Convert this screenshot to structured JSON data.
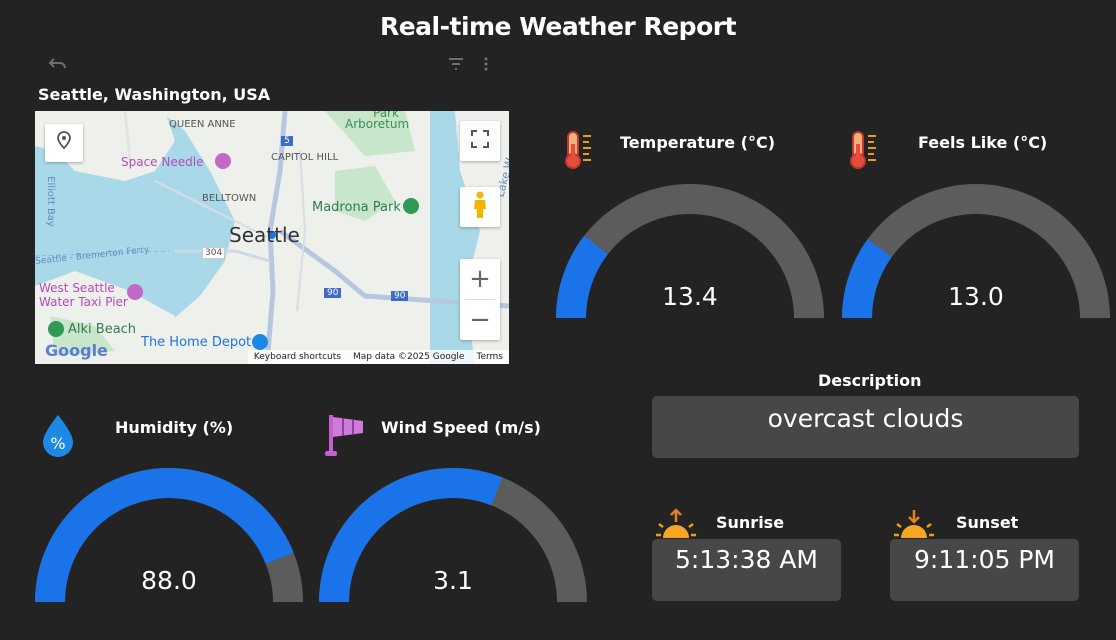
{
  "header": {
    "title": "Real-time Weather Report"
  },
  "toolbar": {
    "undo_icon": "undo-icon",
    "filter_icon": "filter-icon",
    "more_icon": "more-vert-icon"
  },
  "map": {
    "location": "Seattle, Washington, USA",
    "labels": {
      "city": "Seattle",
      "queen_anne": "QUEEN ANNE",
      "park": "Park",
      "arboretum": "Arboretum",
      "capitol_hill": "CAPITOL HILL",
      "space_needle": "Space Needle",
      "belltown": "BELLTOWN",
      "madrona_park": "Madrona Park",
      "elliott_bay": "Elliott Bay",
      "ferry": "Seattle - Bremerton Ferry",
      "west_seattle_1": "West Seattle",
      "west_seattle_2": "Water Taxi Pier",
      "alki_beach": "Alki Beach",
      "home_depot": "The Home Depot",
      "lake_w": "Lake W",
      "route_5": "5",
      "route_304": "304",
      "route_90a": "90",
      "route_90b": "90",
      "google": "Google"
    },
    "attribution": {
      "shortcuts": "Keyboard shortcuts",
      "map_data": "Map data ©2025 Google",
      "terms": "Terms"
    },
    "controls": {
      "zoom_in": "+",
      "zoom_out": "−"
    }
  },
  "gauges": {
    "temperature": {
      "label": "Temperature (°C)",
      "value": "13.4",
      "fraction": 0.21,
      "icon": "thermometer-icon"
    },
    "feels_like": {
      "label": "Feels Like (°C)",
      "value": "13.0",
      "fraction": 0.2,
      "icon": "thermometer-icon"
    },
    "humidity": {
      "label": "Humidity (%)",
      "value": "88.0",
      "fraction": 0.88,
      "icon": "humidity-drop-icon"
    },
    "wind_speed": {
      "label": "Wind Speed (m/s)",
      "value": "3.1",
      "fraction": 0.62,
      "icon": "windsock-icon"
    }
  },
  "description": {
    "label": "Description",
    "value": "overcast clouds"
  },
  "sunrise": {
    "label": "Sunrise",
    "value": "5:13:38 AM",
    "icon": "sunrise-icon"
  },
  "sunset": {
    "label": "Sunset",
    "value": "9:11:05 PM",
    "icon": "sunset-icon"
  },
  "colors": {
    "background": "#232323",
    "gauge_fill": "#1a73e8",
    "gauge_track": "#5c5c5c",
    "box": "#474747"
  }
}
